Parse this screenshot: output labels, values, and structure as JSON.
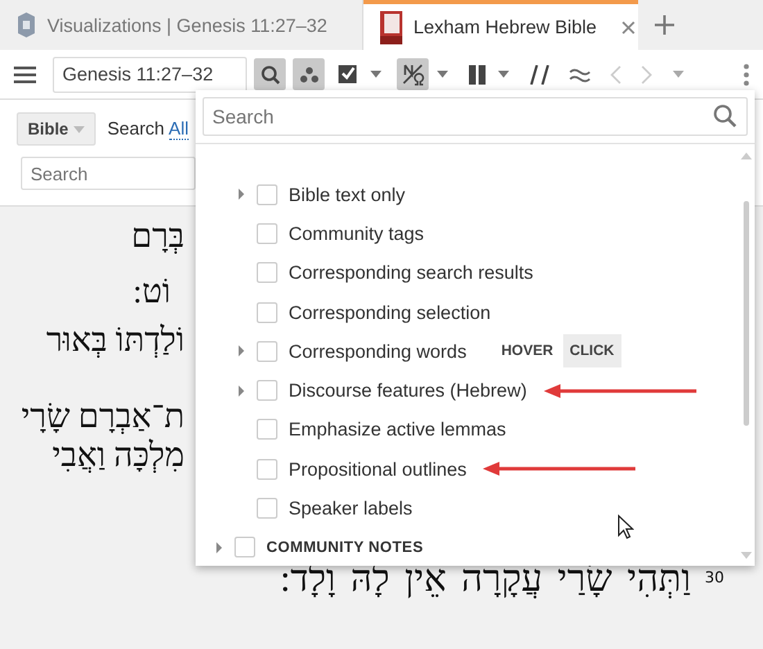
{
  "tabs": [
    {
      "title": "Visualizations | Genesis 11:27–32",
      "selected": false,
      "closable": false
    },
    {
      "title": "Lexham Hebrew Bible",
      "selected": true,
      "closable": true
    }
  ],
  "toolbar": {
    "reference": "Genesis 11:27–32"
  },
  "side_panel": {
    "resource": "Bible",
    "search_label": "Search",
    "scope_link": "All",
    "search_placeholder": "Search"
  },
  "reader": {
    "lines": [
      {
        "text": "בְּרָם"
      },
      {
        "text": "וֹט:"
      },
      {
        "text": "וֹלַדְתּוֹ בְּאוּר"
      },
      {
        "text": "ת־אַבְרָם שָׂרָי"
      },
      {
        "text": "מִלְכָּה וַאֲבִי"
      },
      {
        "text": "וַתְּהִי שָׂרַי עֲקָרָה אֵין לָהּ וָלָד:",
        "verse": "30"
      }
    ]
  },
  "popup": {
    "search_placeholder": "Search",
    "options": [
      {
        "label": "Bible text only",
        "expandable": true,
        "checked": false,
        "annotated": false
      },
      {
        "label": "Community tags",
        "expandable": false,
        "checked": false,
        "annotated": false
      },
      {
        "label": "Corresponding search results",
        "expandable": false,
        "checked": false,
        "annotated": false
      },
      {
        "label": "Corresponding selection",
        "expandable": false,
        "checked": false,
        "annotated": false
      },
      {
        "label": "Corresponding words",
        "expandable": true,
        "checked": false,
        "annotated": false,
        "modes": [
          {
            "label": "HOVER",
            "selected": false
          },
          {
            "label": "CLICK",
            "selected": true
          }
        ]
      },
      {
        "label": "Discourse features (Hebrew)",
        "expandable": true,
        "checked": false,
        "annotated": true
      },
      {
        "label": "Emphasize active lemmas",
        "expandable": false,
        "checked": false,
        "annotated": false
      },
      {
        "label": "Propositional outlines",
        "expandable": false,
        "checked": false,
        "annotated": true
      },
      {
        "label": "Speaker labels",
        "expandable": false,
        "checked": false,
        "annotated": false
      }
    ],
    "section": {
      "label": "COMMUNITY NOTES",
      "expandable": true,
      "checked": false
    }
  }
}
